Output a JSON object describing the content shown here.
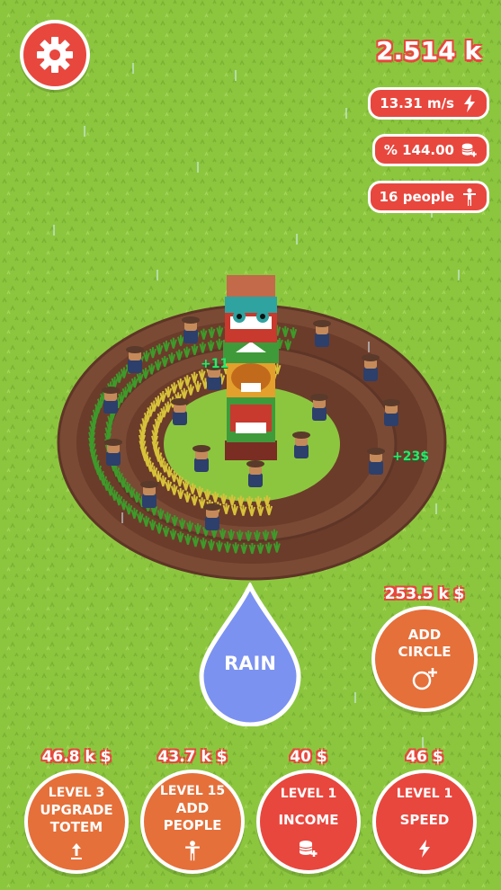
{
  "hud": {
    "money": "2.514 k",
    "rate": "13.31 m/s",
    "income_percent": "% 144.00",
    "people": "16 people"
  },
  "floating": {
    "plus_people": "+11",
    "plus_money": "+23$"
  },
  "rain_button": {
    "label": "RAIN"
  },
  "add_circle": {
    "price": "253.5 k $",
    "line1": "ADD",
    "line2": "CIRCLE"
  },
  "bottom_buttons": [
    {
      "price": "46.8 k $",
      "level": "LEVEL 3",
      "line1": "UPGRADE",
      "line2": "TOTEM",
      "icon": "arrow-up-icon",
      "color": "#e5703a"
    },
    {
      "price": "43.7 k $",
      "level": "LEVEL 15",
      "line1": "ADD",
      "line2": "PEOPLE",
      "icon": "person-icon",
      "color": "#e5703a"
    },
    {
      "price": "40 $",
      "level": "LEVEL 1",
      "line1": "INCOME",
      "line2": "",
      "icon": "coins-plus-icon",
      "color": "#e8473e"
    },
    {
      "price": "46 $",
      "level": "LEVEL 1",
      "line1": "SPEED",
      "line2": "",
      "icon": "lightning-icon",
      "color": "#e8473e"
    }
  ],
  "colors": {
    "grass": "#8cc63f",
    "accent_red": "#e8473e",
    "accent_orange": "#e5703a",
    "rain_blue": "#7b92f0",
    "path_brown": "#7a4a35"
  }
}
